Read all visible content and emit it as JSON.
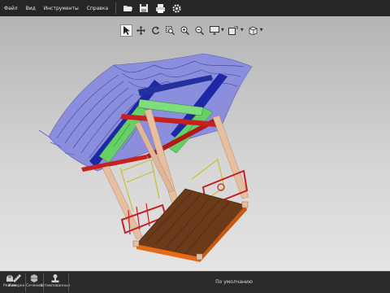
{
  "menubar": {
    "items": [
      {
        "label": "Файл"
      },
      {
        "label": "Вид"
      },
      {
        "label": "Инструменты"
      },
      {
        "label": "Справка"
      }
    ],
    "toolbar_icons": [
      "open-file-icon",
      "save-icon",
      "print-icon",
      "settings-icon"
    ]
  },
  "view_toolbar": {
    "tools": [
      "select-cursor-icon",
      "pan-icon",
      "rotate-icon",
      "zoom-region-icon",
      "zoom-in-icon",
      "zoom-out-icon",
      "display-mode-icon",
      "views-icon",
      "box-view-icon"
    ]
  },
  "statusbar": {
    "tools": [
      {
        "label": "Режим",
        "icon": "mode-icon"
      },
      {
        "label": "Измерен.",
        "icon": "measure-icon"
      },
      {
        "label": "Сечения",
        "icon": "sections-icon"
      },
      {
        "label": "Штампованные",
        "icon": "stamp-icon"
      }
    ],
    "default_view": "По умолчанию"
  },
  "colors": {
    "roof": "#7d80d2",
    "beam_green": "#66d066",
    "beam_blue": "#1c28a6",
    "red_rail": "#c62020",
    "column": "#e7bfa0",
    "floor": "#6b3a1a",
    "floor_edge": "#e46a16"
  }
}
